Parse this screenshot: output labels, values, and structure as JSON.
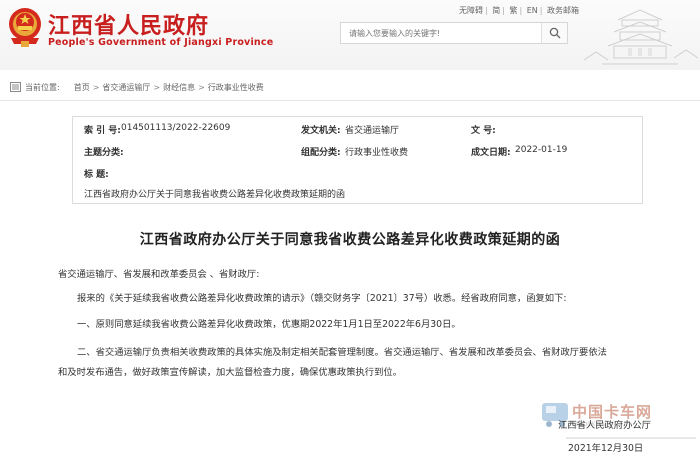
{
  "header": {
    "title_cn": "江西省人民政府",
    "title_en": "People's Government of Jiangxi Province",
    "toplinks": [
      "无障碍",
      "简",
      "繁",
      "EN",
      "政务邮箱"
    ],
    "search_placeholder": "请输入您要输入的关键字!"
  },
  "breadcrumb": {
    "label": "当前位置:",
    "items": [
      "首页",
      "省交通运输厅",
      "财经信息",
      "行政事业性收费"
    ]
  },
  "info": {
    "index_label": "索 引 号:",
    "index_value": "014501113/2022-22609",
    "issuer_label": "发文机关:",
    "issuer_value": "省交通运输厅",
    "docno_label": "文 号:",
    "docno_value": "",
    "topic_label": "主题分类:",
    "topic_value": "",
    "org_label": "组配分类:",
    "org_value": "行政事业性收费",
    "date_label": "成文日期:",
    "date_value": "2022-01-19",
    "title_label": "标 题:",
    "title_value": "江西省政府办公厅关于同意我省收费公路差异化收费政策延期的函"
  },
  "article": {
    "title": "江西省政府办公厅关于同意我省收费公路差异化收费政策延期的函",
    "recipients": "省交通运输厅、省发展和改革委员会 、省财政厅:",
    "p1": "报来的《关于延续我省收费公路差异化收费政策的请示》（赣交财务字〔2021〕37号）收悉。经省政府同意，函复如下:",
    "p2": "一、原则同意延续我省收费公路差异化收费政策，优惠期2022年1月1日至2022年6月30日。",
    "p3a": "二、省交通运输厅负责相关收费政策的具体实施及制定相关配套管理制度。省交通运输厅、省发展和改革委员会、省财政厅要依法",
    "p3b": "和及时发布通告，做好政策宣传解读，加大监督检查力度，确保优惠政策执行到位。",
    "signer": "江西省人民政府办公厅",
    "date": "2021年12月30日"
  },
  "watermark": {
    "cn": "中国卡车网",
    "en": "TRUCK.CN"
  },
  "colors": {
    "brand_red": "#c81e1e"
  }
}
